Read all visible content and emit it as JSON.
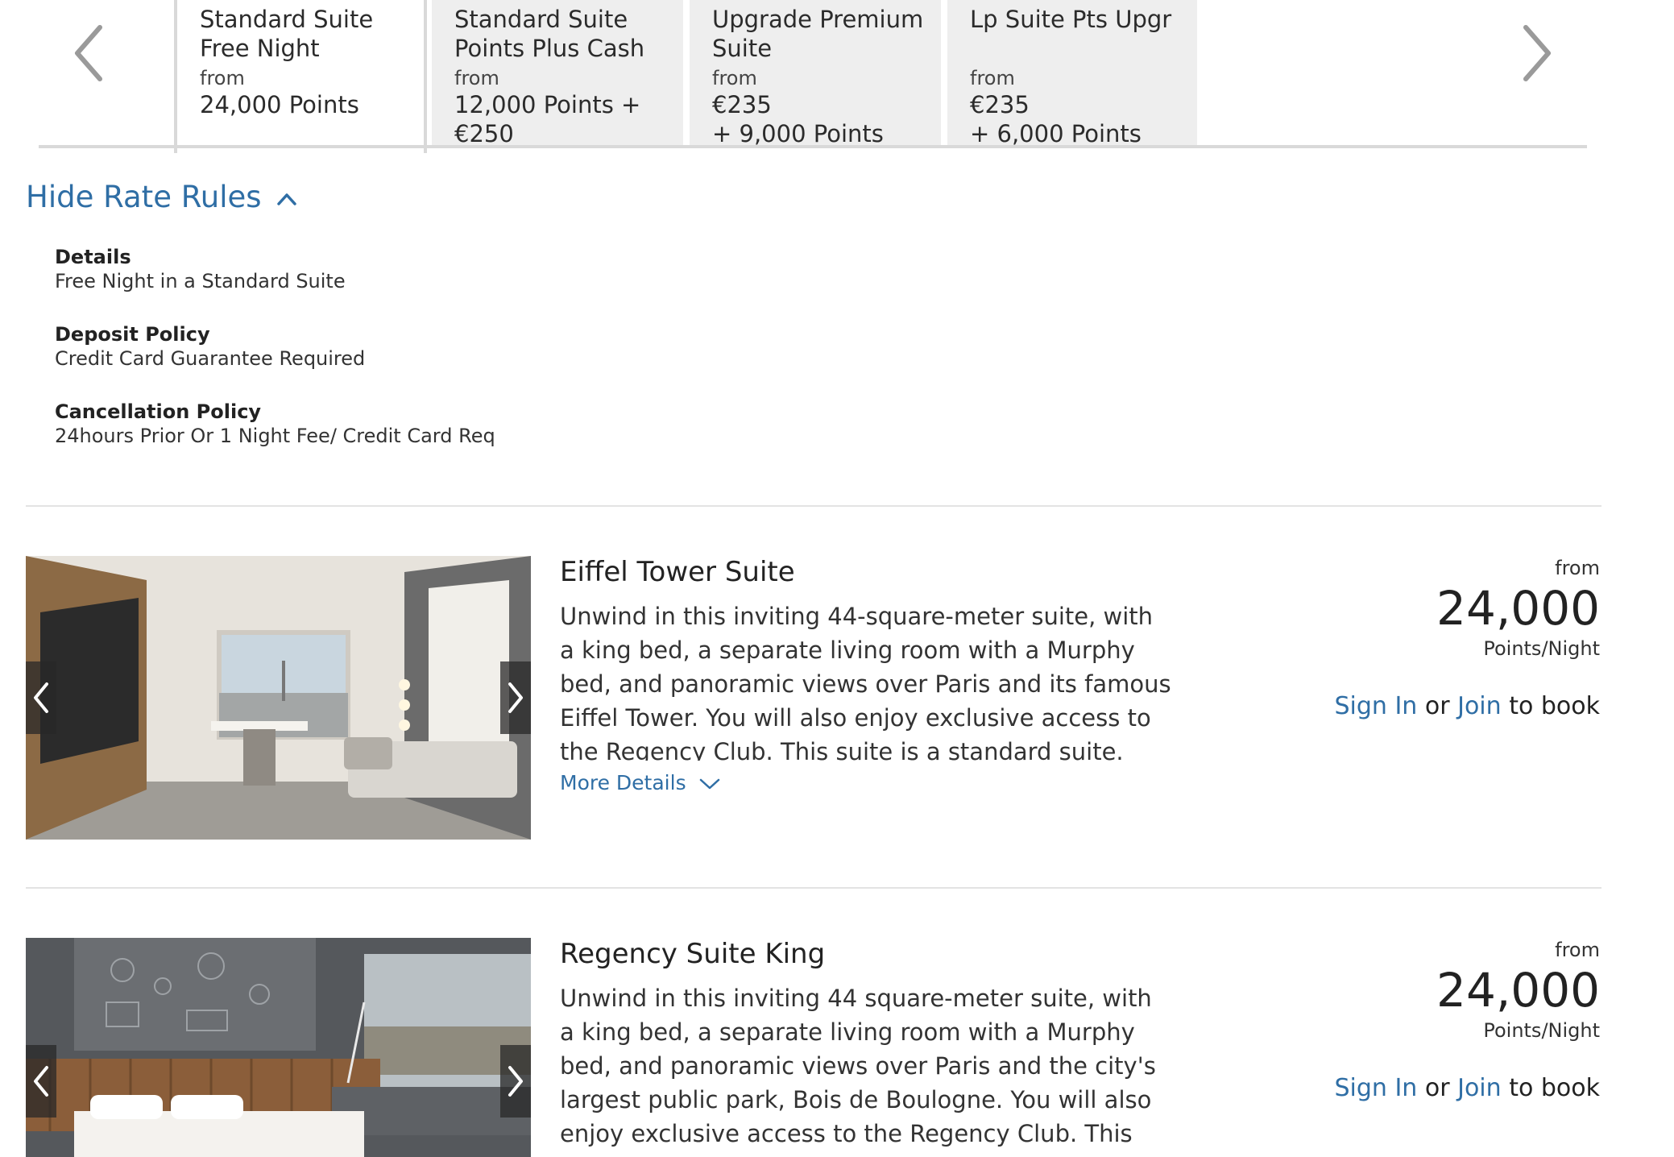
{
  "colors": {
    "link": "#2f6ea5",
    "tab_inactive_bg": "#eeeeee",
    "divider": "#e3e3e3",
    "text": "#333333"
  },
  "rate_tabs": [
    {
      "name": "Standard Suite Free Night",
      "from": "from",
      "price_line1": "24,000 Points",
      "price_line2": "",
      "active": true
    },
    {
      "name": "Standard Suite Points Plus Cash",
      "from": "from",
      "price_line1": "12,000 Points +",
      "price_line2": "€250",
      "active": false
    },
    {
      "name": "Upgrade Premium Suite",
      "from": "from",
      "price_line1": "€235",
      "price_line2": "+ 9,000 Points",
      "active": false
    },
    {
      "name": "Lp Suite Pts Upgr",
      "from": "from",
      "price_line1": "€235",
      "price_line2": "+ 6,000 Points",
      "active": false
    }
  ],
  "nav": {
    "prev_icon": "chevron-left-icon",
    "next_icon": "chevron-right-icon"
  },
  "rate_rules": {
    "toggle_label": "Hide Rate Rules",
    "toggle_icon": "chevron-up-icon",
    "items": [
      {
        "label": "Details",
        "value": "Free Night in a Standard Suite"
      },
      {
        "label": "Deposit Policy",
        "value": "Credit Card Guarantee Required"
      },
      {
        "label": "Cancellation Policy",
        "value": "24hours Prior Or 1 Night Fee/ Credit Card Req"
      }
    ]
  },
  "rooms": [
    {
      "name": "Eiffel Tower Suite",
      "description": "Unwind in this inviting 44-square-meter suite, with a king bed, a separate living room with a Murphy bed, and panoramic views over Paris and its famous Eiffel Tower. You will also enjoy exclusive access to the Regency Club. This suite is a standard suite. See World of Hyatt program",
      "more_details": "More Details",
      "price_from": "from",
      "price_amount": "24,000",
      "price_unit": "Points/Night",
      "sign_in": "Sign In",
      "or": "or",
      "join": "Join",
      "to_book": "to book"
    },
    {
      "name": "Regency Suite King",
      "description": "Unwind in this inviting 44 square-meter suite, with a king bed, a separate living room with a Murphy bed, and panoramic views over Paris and the city's largest public park, Bois de Boulogne. You will also enjoy exclusive access to the Regency Club. This suite is a standard suite.",
      "more_details": "",
      "price_from": "from",
      "price_amount": "24,000",
      "price_unit": "Points/Night",
      "sign_in": "Sign In",
      "or": "or",
      "join": "Join",
      "to_book": "to book"
    }
  ]
}
